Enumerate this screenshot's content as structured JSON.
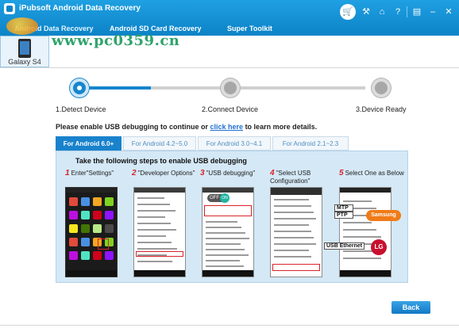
{
  "app": {
    "title": "iPubsoft Android Data Recovery"
  },
  "nav": {
    "tabs": [
      "Android Data Recovery",
      "Android SD Card Recovery",
      "Super Toolkit"
    ],
    "active": 0
  },
  "watermark": "www.pc0359.cn",
  "topbar": {
    "icons": [
      "cart-icon",
      "key-icon",
      "home-icon",
      "help-icon",
      "register-icon",
      "minimize-icon",
      "close-icon"
    ],
    "glyphs": [
      "🛒",
      "⚒",
      "⌂",
      "?",
      "▤",
      "–",
      "✕"
    ]
  },
  "device": {
    "name": "Galaxy S4"
  },
  "steps": [
    {
      "label": "1.Detect Device"
    },
    {
      "label": "2.Connect Device"
    },
    {
      "label": "3.Device Ready"
    }
  ],
  "progress_fraction": 0.25,
  "instruction": {
    "before": "Please enable USB debugging to continue or ",
    "link": "click here",
    "after": " to learn more details."
  },
  "android_tabs": [
    "For Android 6.0+",
    "For Android 4.2~5.0",
    "For Android 3.0~4.1",
    "For Android 2.1~2.3"
  ],
  "android_active": 0,
  "guide": {
    "title": "Take the following steps to enable USB debugging",
    "steps": [
      {
        "num": "1",
        "text": "Enter\"Settings\""
      },
      {
        "num": "2",
        "text": "\"Developer Options\""
      },
      {
        "num": "3",
        "text": "\"USB debugging\""
      },
      {
        "num": "4",
        "text": "\"Select USB\nConfiguration\""
      },
      {
        "num": "5",
        "text": "Select One as Below"
      }
    ],
    "callouts": {
      "mtp": "MTP",
      "ptp": "PTP",
      "samsung": "Samsung",
      "lg": "LG",
      "usb_ethernet": "USB Ethernet"
    },
    "toggle_off": "OFF",
    "toggle_on": "ON"
  },
  "colors": {
    "accent": "#1686cf",
    "title_bar": "#0c83c7",
    "highlight": "#d8232a",
    "samsung": "#f07b18",
    "lg": "#c8102e"
  },
  "buttons": {
    "back": "Back"
  }
}
